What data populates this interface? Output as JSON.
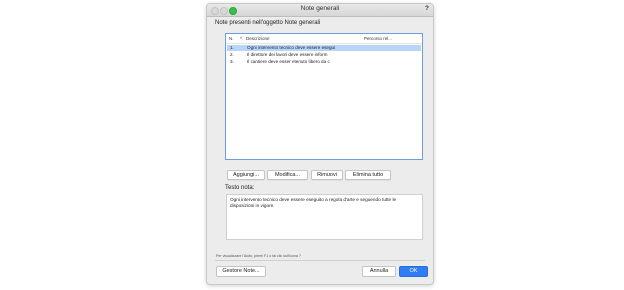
{
  "window": {
    "title": "Note generali",
    "help_icon": "?"
  },
  "section_label": "Note presenti nell'oggetto Note generali",
  "list": {
    "columns": [
      "N.",
      "Descrizione",
      "Percorso rel..."
    ],
    "sort_indicator": "^",
    "rows": [
      {
        "n": "1.",
        "desc": "Ogni intervento tecnico deve essere esegui",
        "selected": true
      },
      {
        "n": "2.",
        "desc": "Il direttore dei lavori deve essere inform",
        "selected": false
      },
      {
        "n": "3.",
        "desc": "Il cantiere deve esser etenuto libero da c",
        "selected": false
      }
    ]
  },
  "buttons": {
    "add": "Aggiungi...",
    "edit": "Modifica...",
    "remove": "Rimuovi",
    "remove_all": "Elimina tutto"
  },
  "note": {
    "label": "Testo nota:",
    "text": "Ogni intervento tecnico deve essere eseguito a regola d'arte e seguendo tutte le disposizioni in vigore."
  },
  "hint": "Per visualizzare l'Aiuto, premi F1 o fai clic sull'icona ?",
  "footer": {
    "manage": "Gestore Note...",
    "cancel": "Annulla",
    "ok": "OK"
  },
  "colors": {
    "accent": "#2f7cf6",
    "selection": "#b8d4f8",
    "focus_border": "#6b9be0"
  }
}
